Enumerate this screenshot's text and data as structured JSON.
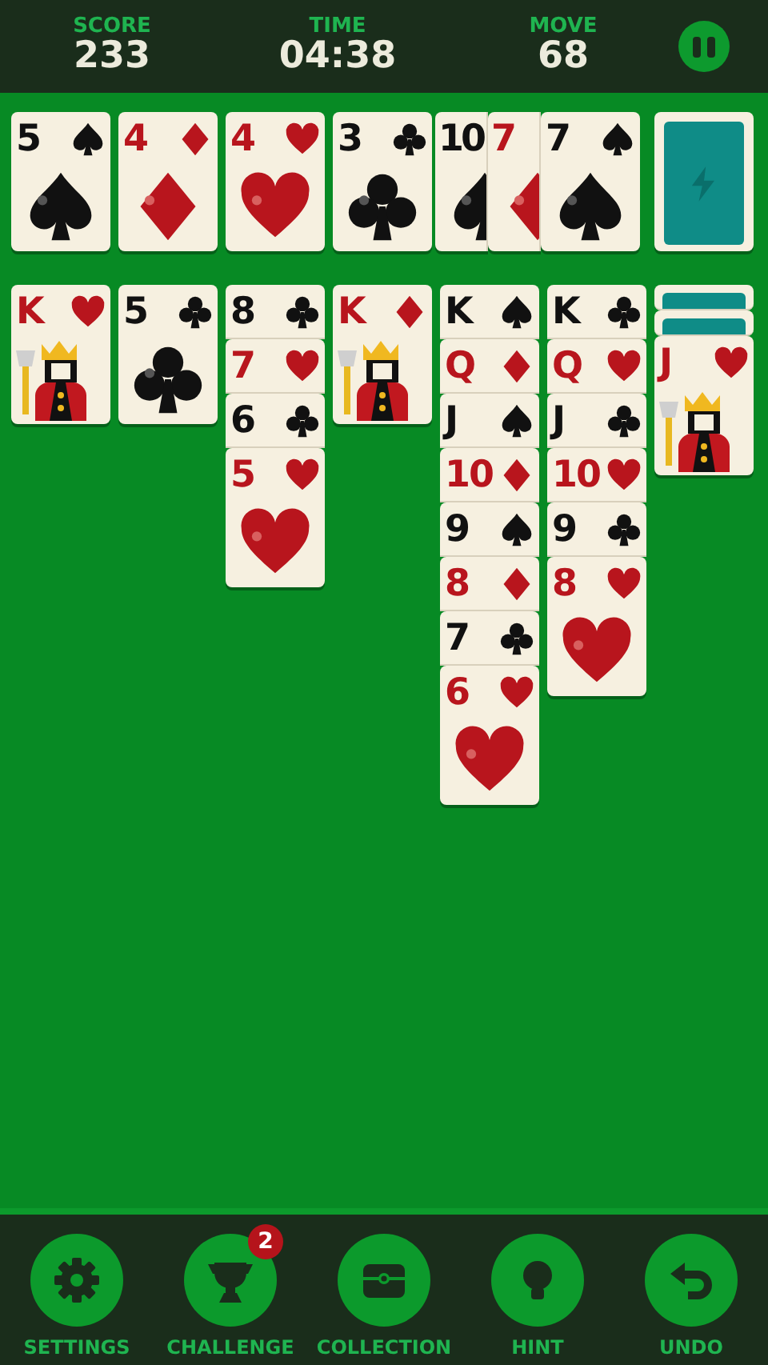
{
  "header": {
    "stats": [
      {
        "label": "SCORE",
        "value": "233"
      },
      {
        "label": "TIME",
        "value": "04:38"
      },
      {
        "label": "MOVE",
        "value": "68"
      }
    ]
  },
  "foundations": [
    {
      "rank": "5",
      "kind": "spades",
      "court": false
    },
    {
      "rank": "4",
      "kind": "diamonds",
      "court": false
    },
    {
      "rank": "4",
      "kind": "hearts",
      "court": false
    },
    {
      "rank": "3",
      "kind": "clubs",
      "court": false
    }
  ],
  "waste": [
    {
      "rank": "10",
      "kind": "spades",
      "court": false
    },
    {
      "rank": "7",
      "kind": "diamonds",
      "court": false
    },
    {
      "rank": "7",
      "kind": "spades",
      "court": false
    }
  ],
  "tableau": [
    {
      "cards": [
        {
          "face_up": true,
          "rank": "K",
          "kind": "hearts",
          "court": true
        }
      ]
    },
    {
      "cards": [
        {
          "face_up": true,
          "rank": "5",
          "kind": "clubs",
          "court": false
        }
      ]
    },
    {
      "cards": [
        {
          "face_up": true,
          "rank": "8",
          "kind": "clubs"
        },
        {
          "face_up": true,
          "rank": "7",
          "kind": "hearts"
        },
        {
          "face_up": true,
          "rank": "6",
          "kind": "clubs"
        },
        {
          "face_up": true,
          "rank": "5",
          "kind": "hearts",
          "court": false
        }
      ]
    },
    {
      "cards": [
        {
          "face_up": true,
          "rank": "K",
          "kind": "diamonds",
          "court": true
        }
      ]
    },
    {
      "cards": [
        {
          "face_up": true,
          "rank": "K",
          "kind": "spades"
        },
        {
          "face_up": true,
          "rank": "Q",
          "kind": "diamonds"
        },
        {
          "face_up": true,
          "rank": "J",
          "kind": "spades"
        },
        {
          "face_up": true,
          "rank": "10",
          "kind": "diamonds"
        },
        {
          "face_up": true,
          "rank": "9",
          "kind": "spades"
        },
        {
          "face_up": true,
          "rank": "8",
          "kind": "diamonds"
        },
        {
          "face_up": true,
          "rank": "7",
          "kind": "clubs"
        },
        {
          "face_up": true,
          "rank": "6",
          "kind": "hearts",
          "court": false
        }
      ]
    },
    {
      "cards": [
        {
          "face_up": true,
          "rank": "K",
          "kind": "clubs"
        },
        {
          "face_up": true,
          "rank": "Q",
          "kind": "hearts"
        },
        {
          "face_up": true,
          "rank": "J",
          "kind": "clubs"
        },
        {
          "face_up": true,
          "rank": "10",
          "kind": "hearts"
        },
        {
          "face_up": true,
          "rank": "9",
          "kind": "clubs"
        },
        {
          "face_up": true,
          "rank": "8",
          "kind": "hearts",
          "court": false
        }
      ]
    },
    {
      "cards": [
        {
          "face_up": false
        },
        {
          "face_up": false
        },
        {
          "face_up": true,
          "rank": "J",
          "kind": "hearts",
          "court": true
        }
      ]
    }
  ],
  "toolbar": [
    {
      "label": "SETTINGS"
    },
    {
      "label": "CHALLENGE",
      "badge": "2"
    },
    {
      "label": "COLLECTION"
    },
    {
      "label": "HINT"
    },
    {
      "label": "UNDO"
    }
  ]
}
